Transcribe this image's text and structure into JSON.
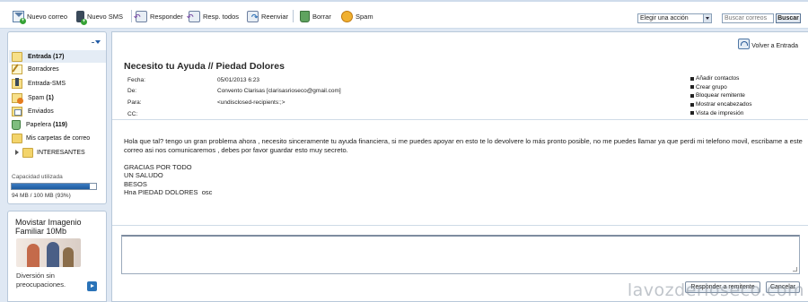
{
  "toolbar": {
    "new_mail": "Nuevo correo",
    "new_sms": "Nuevo SMS",
    "reply": "Responder",
    "reply_all": "Resp. todos",
    "forward": "Reenviar",
    "delete": "Borrar",
    "spam": "Spam",
    "action_select": "Elegir una acción",
    "search_placeholder": "Buscar correos",
    "search_button": "Buscar"
  },
  "sidebar": {
    "folders": [
      {
        "label": "Entrada",
        "count": "(17)",
        "icon": "inbox-icon"
      },
      {
        "label": "Borradores",
        "count": "",
        "icon": "drafts-icon"
      },
      {
        "label": "Entrada-SMS",
        "count": "",
        "icon": "sms-icon"
      },
      {
        "label": "Spam",
        "count": "(1)",
        "icon": "spam-icon"
      },
      {
        "label": "Enviados",
        "count": "",
        "icon": "sent-icon"
      },
      {
        "label": "Papelera",
        "count": "(119)",
        "icon": "trash-icon"
      }
    ],
    "my_folders": "Mis carpetas de correo",
    "sub_folder": "INTERESANTES",
    "capacity_label": "Capacidad utilizada",
    "capacity_text": "94 MB / 100 MB (93%)",
    "capacity_percent": 93
  },
  "ad": {
    "title": "Movistar Imagenio Familiar 10Mb",
    "subtitle": "Diversión sin preocupaciones."
  },
  "message": {
    "back_link": "Volver a Entrada",
    "subject": "Necesito tu Ayuda // Piedad Dolores",
    "headers": [
      {
        "label": "Fecha:",
        "value": "05/01/2013 6:23"
      },
      {
        "label": "De:",
        "value": "Convento Clarisas [clarisasrioseco@gmail.com]"
      },
      {
        "label": "Para:",
        "value": "<undisclosed-recipients:;>"
      },
      {
        "label": "CC:",
        "value": ""
      }
    ],
    "actions": [
      "Añadir contactos",
      "Crear grupo",
      "Bloquear remitente",
      "Mostrar encabezados",
      "Vista de impresión"
    ],
    "body": "Hola que tal? tengo un gran problema ahora , necesito sinceramente tu ayuda financiera, si me puedes apoyar en esto te lo devolvere lo más pronto posible, no me puedes llamar ya que perdi mi telefono movil, escribame a este correo asi nos comunicaremos , debes por favor guardar esto muy secreto.\n\nGRACIAS POR TODO\nUN SALUDO\nBESOS\nHna PIEDAD DOLORES  osc",
    "reply_button": "Responder a remitente",
    "cancel_button": "Cancelar"
  },
  "watermark": "lavozderioseco.com"
}
